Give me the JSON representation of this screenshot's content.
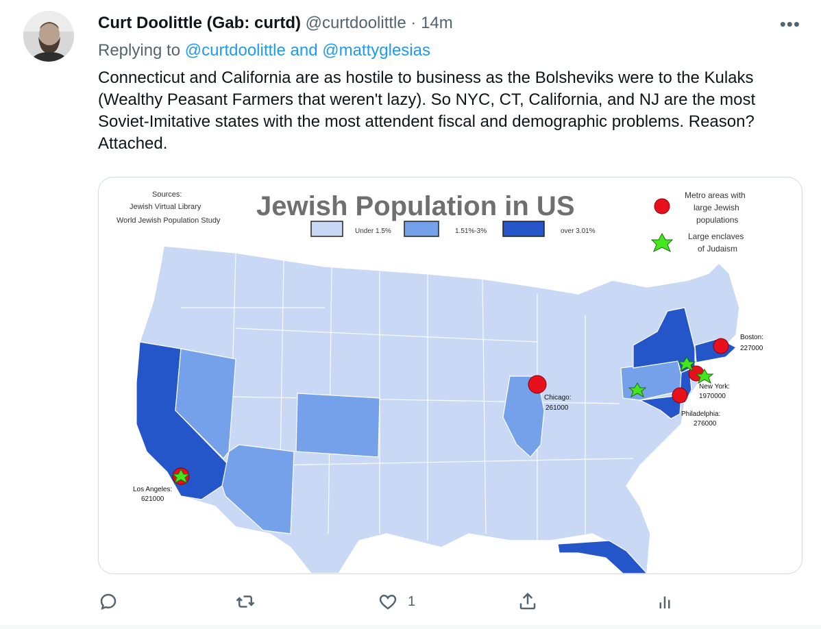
{
  "tweet": {
    "author_name": "Curt Doolittle (Gab: curtd)",
    "author_handle": "@curtdoolittle",
    "separator": "·",
    "time": "14m",
    "more_label": "•••",
    "reply_prefix": "Replying to",
    "reply_to": "@curtdoolittle and @mattyglesias",
    "text": "Connecticut and California are as hostile to business as the Bolsheviks were to the Kulaks (Wealthy Peasant Farmers that weren't lazy). So NYC, CT, California, and NJ are the most Soviet-Imitative states with the most attendent fiscal and demographic problems. Reason? Attached."
  },
  "media": {
    "title": "Jewish Population in US",
    "sources_label": "Sources:",
    "source_1": "Jewish Virtual Library",
    "source_2": "World Jewish Population Study",
    "legend": {
      "low": "Under 1.5%",
      "mid": "1.51%-3%",
      "high": "over 3.01%",
      "metro_line1": "Metro areas with",
      "metro_line2": "large Jewish",
      "metro_line3": "populations",
      "enclave_line1": "Large enclaves",
      "enclave_line2": "of Judaism"
    },
    "colors": {
      "low": "#c9d9f5",
      "mid": "#74a1ea",
      "high": "#2456c9",
      "metro": "#e8101c",
      "enclave": "#44e61e"
    },
    "cities": [
      {
        "name": "Boston:",
        "pop": "227000"
      },
      {
        "name": "New York:",
        "pop": "1970000"
      },
      {
        "name": "Chicago:",
        "pop": "261000"
      },
      {
        "name": "Philadelphia:",
        "pop": "276000"
      },
      {
        "name": "Los Angeles:",
        "pop": "621000"
      }
    ]
  },
  "actions": {
    "reply_icon": "reply-icon",
    "retweet_icon": "retweet-icon",
    "like_icon": "like-icon",
    "like_count": "1",
    "share_icon": "share-icon",
    "analytics_icon": "analytics-icon"
  }
}
